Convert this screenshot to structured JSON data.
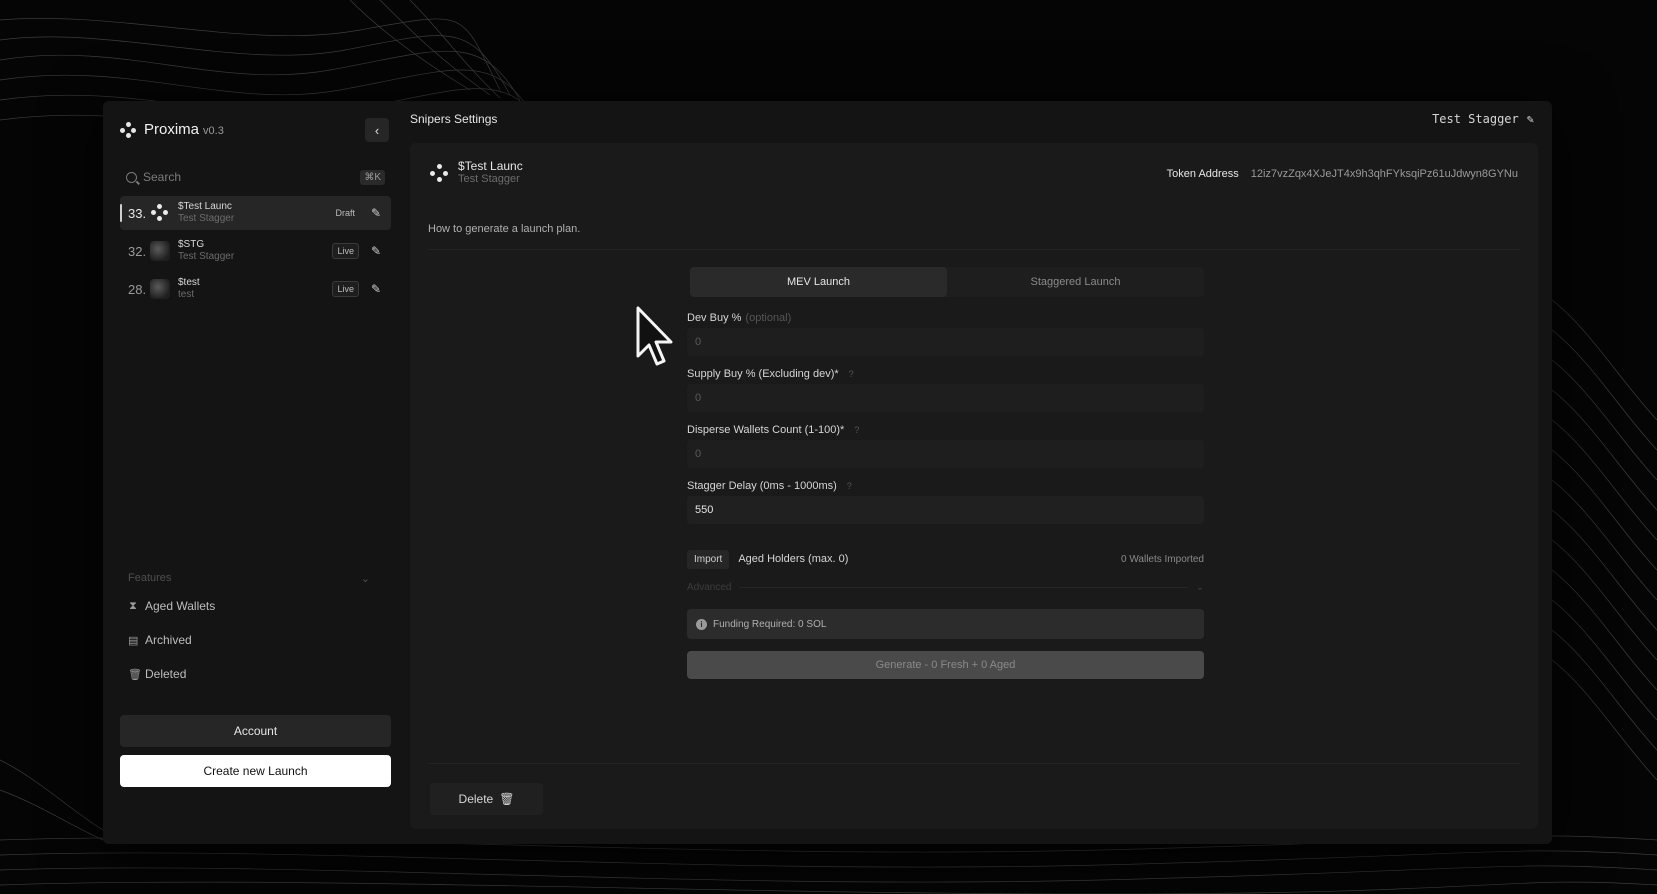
{
  "app": {
    "name": "Proxima",
    "version": "v0.3"
  },
  "sidebar": {
    "search_placeholder": "Search",
    "search_shortcut": "⌘K",
    "launches": [
      {
        "num": "33.",
        "title": "$Test Launc",
        "subtitle": "Test Stagger",
        "badge": "Draft",
        "active": true,
        "avatar": "proxima-logo"
      },
      {
        "num": "32.",
        "title": "$STG",
        "subtitle": "Test Stagger",
        "badge": "Live",
        "active": false,
        "avatar": "token-image"
      },
      {
        "num": "28.",
        "title": "$test",
        "subtitle": "test",
        "badge": "Live",
        "active": false,
        "avatar": "token-image"
      }
    ],
    "features_label": "Features",
    "features": [
      {
        "label": "Aged Wallets",
        "icon": "hourglass-icon"
      },
      {
        "label": "Archived",
        "icon": "archive-icon"
      },
      {
        "label": "Deleted",
        "icon": "trash-icon"
      }
    ],
    "account_label": "Account",
    "create_label": "Create new Launch"
  },
  "header": {
    "title": "Snipers Settings",
    "right_label": "Test Stagger"
  },
  "token": {
    "name": "$Test Launc",
    "subtitle": "Test Stagger",
    "address_label": "Token Address",
    "address": "12iz7vzZqx4XJeJT4x9h3qhFYksqiPz61uJdwyn8GYNu"
  },
  "howto": "How to generate a launch plan.",
  "tabs": [
    {
      "label": "MEV Launch",
      "active": true
    },
    {
      "label": "Staggered Launch",
      "active": false
    }
  ],
  "form": {
    "dev_buy": {
      "label": "Dev Buy %",
      "optional": "(optional)",
      "value": "0"
    },
    "supply_buy": {
      "label": "Supply Buy % (Excluding dev)*",
      "help": "?",
      "value": "0"
    },
    "disperse": {
      "label": "Disperse Wallets Count (1-100)*",
      "help": "?",
      "value": "0"
    },
    "stagger": {
      "label": "Stagger Delay (0ms - 1000ms)",
      "help": "?",
      "value": "550"
    },
    "import_label": "Import",
    "aged_label": "Aged Holders (max. 0)",
    "imported_label": "0 Wallets Imported",
    "advanced_label": "Advanced",
    "funding": "Funding Required: 0 SOL",
    "generate": "Generate - 0 Fresh + 0 Aged"
  },
  "delete_label": "Delete",
  "colors": {
    "background": "#050505",
    "window": "#141414",
    "panel": "#1a1a1a",
    "accent": "#ffffff"
  }
}
